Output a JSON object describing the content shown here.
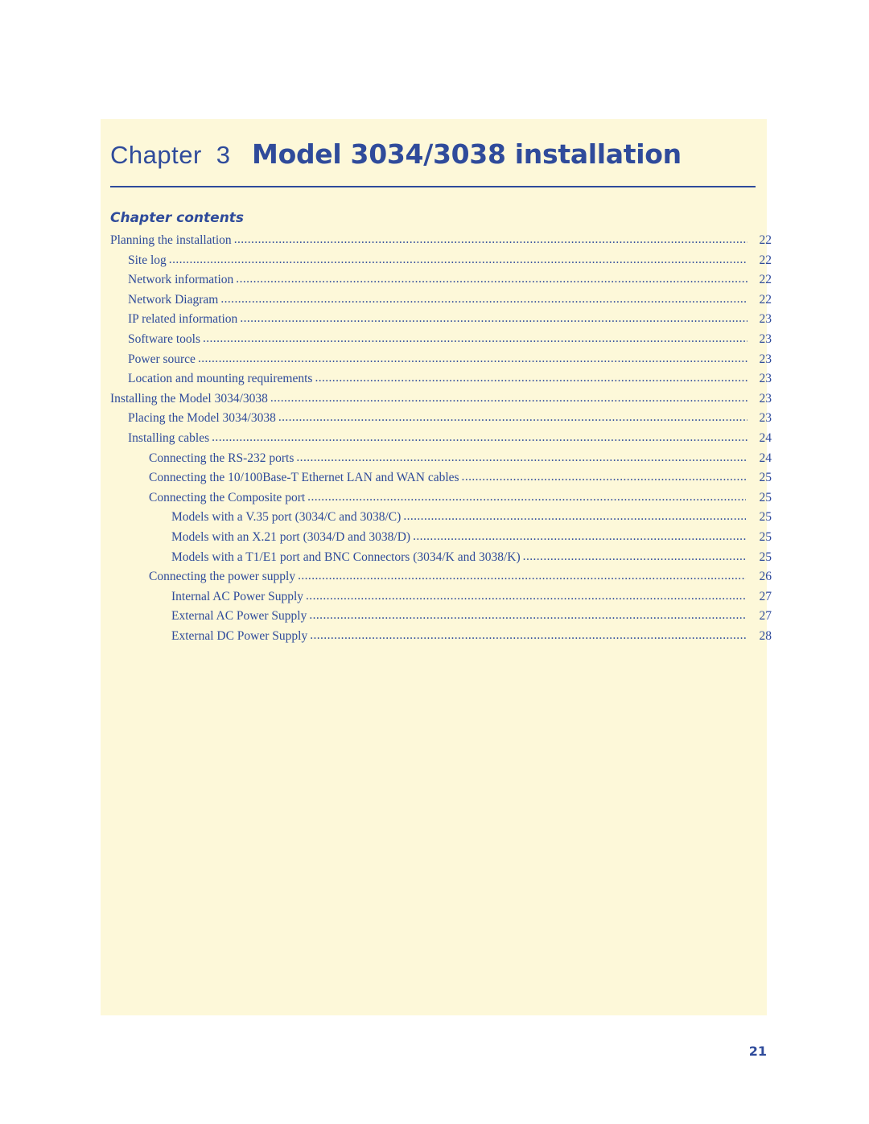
{
  "header": {
    "chapter_word": "Chapter",
    "chapter_number": "3",
    "title": "Model 3034/3038 installation",
    "contents_label": "Chapter contents"
  },
  "colors": {
    "accent": "#2f4b9b",
    "panel": "#fdf8d9"
  },
  "toc": [
    {
      "text": "Planning the installation",
      "page": "22",
      "level": 0
    },
    {
      "text": "Site log",
      "page": "22",
      "level": 1
    },
    {
      "text": "Network information",
      "page": "22",
      "level": 1
    },
    {
      "text": "Network Diagram",
      "page": "22",
      "level": 1
    },
    {
      "text": "IP related information",
      "page": "23",
      "level": 1
    },
    {
      "text": "Software tools",
      "page": "23",
      "level": 1
    },
    {
      "text": "Power source",
      "page": "23",
      "level": 1
    },
    {
      "text": "Location and mounting requirements",
      "page": "23",
      "level": 1
    },
    {
      "text": "Installing the Model 3034/3038",
      "page": "23",
      "level": 0
    },
    {
      "text": "Placing the Model 3034/3038",
      "page": "23",
      "level": 1
    },
    {
      "text": "Installing cables",
      "page": "24",
      "level": 1
    },
    {
      "text": "Connecting the RS-232 ports",
      "page": "24",
      "level": 2
    },
    {
      "text": "Connecting the 10/100Base-T Ethernet LAN and WAN cables",
      "page": "25",
      "level": 2
    },
    {
      "text": "Connecting the Composite port",
      "page": "25",
      "level": 2
    },
    {
      "text": "Models with a V.35 port (3034/C and 3038/C)",
      "page": "25",
      "level": 3
    },
    {
      "text": "Models with an X.21 port (3034/D and 3038/D)",
      "page": "25",
      "level": 3
    },
    {
      "text": "Models with a T1/E1 port and BNC Connectors (3034/K and 3038/K)",
      "page": "25",
      "level": 3
    },
    {
      "text": "Connecting the power supply",
      "page": "26",
      "level": 2
    },
    {
      "text": "Internal AC Power Supply",
      "page": "27",
      "level": 3
    },
    {
      "text": "External AC Power Supply",
      "page": "27",
      "level": 3
    },
    {
      "text": "External DC Power Supply",
      "page": "28",
      "level": 3
    }
  ],
  "footer": {
    "page_number": "21"
  }
}
